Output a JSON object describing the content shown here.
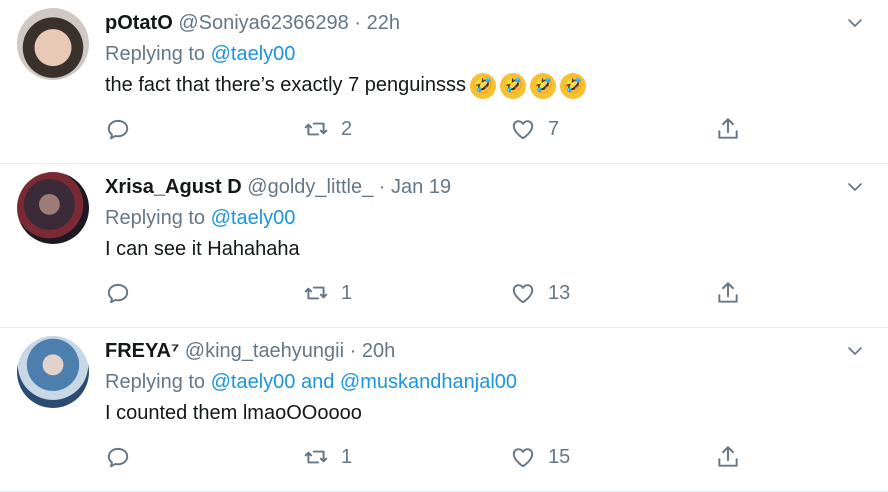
{
  "tweets": [
    {
      "name": "pOtatO",
      "handle": "@Soniya62366298",
      "dot": "·",
      "time": "22h",
      "replying_prefix": "Replying to",
      "replying_to": [
        "@taely00"
      ],
      "text": "the fact that there’s exactly 7 penguinsss",
      "emoji": [
        "rolling-on-floor-laughing",
        "rolling-on-floor-laughing",
        "rolling-on-floor-laughing",
        "rolling-on-floor-laughing"
      ],
      "emoji_glyph": "🤣",
      "replies": "",
      "retweets": "2",
      "likes": "7"
    },
    {
      "name": "Xrisa_Agust D",
      "handle": "@goldy_little_",
      "dot": "·",
      "time": "Jan 19",
      "replying_prefix": "Replying to",
      "replying_to": [
        "@taely00"
      ],
      "text": "I can see it Hahahaha",
      "replies": "",
      "retweets": "1",
      "likes": "13"
    },
    {
      "name": "FREYA⁷",
      "handle": "@king_taehyungii",
      "dot": "·",
      "time": "20h",
      "replying_prefix": "Replying to",
      "replying_to": [
        "@taely00",
        "@muskandhanjal00"
      ],
      "replying_joiner": "and",
      "text": "I counted them lmaoOOoooo",
      "replies": "",
      "retweets": "1",
      "likes": "15"
    }
  ],
  "colors": {
    "text": "#14171a",
    "muted": "#657786",
    "link": "#1b95e0",
    "divider": "#e6ecf0"
  },
  "icons": [
    "chevron-down-icon",
    "reply-icon",
    "retweet-icon",
    "like-icon",
    "share-icon"
  ]
}
